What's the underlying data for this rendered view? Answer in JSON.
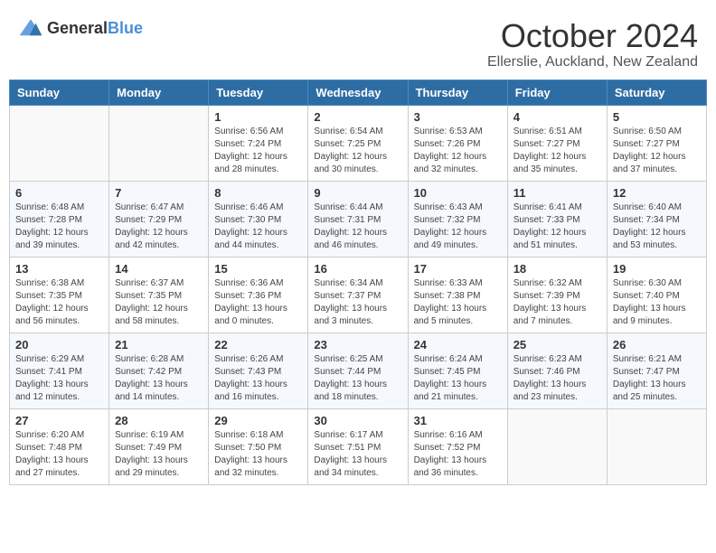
{
  "header": {
    "logo_general": "General",
    "logo_blue": "Blue",
    "month_title": "October 2024",
    "location": "Ellerslie, Auckland, New Zealand"
  },
  "weekdays": [
    "Sunday",
    "Monday",
    "Tuesday",
    "Wednesday",
    "Thursday",
    "Friday",
    "Saturday"
  ],
  "weeks": [
    [
      {
        "day": "",
        "info": ""
      },
      {
        "day": "",
        "info": ""
      },
      {
        "day": "1",
        "info": "Sunrise: 6:56 AM\nSunset: 7:24 PM\nDaylight: 12 hours and 28 minutes."
      },
      {
        "day": "2",
        "info": "Sunrise: 6:54 AM\nSunset: 7:25 PM\nDaylight: 12 hours and 30 minutes."
      },
      {
        "day": "3",
        "info": "Sunrise: 6:53 AM\nSunset: 7:26 PM\nDaylight: 12 hours and 32 minutes."
      },
      {
        "day": "4",
        "info": "Sunrise: 6:51 AM\nSunset: 7:27 PM\nDaylight: 12 hours and 35 minutes."
      },
      {
        "day": "5",
        "info": "Sunrise: 6:50 AM\nSunset: 7:27 PM\nDaylight: 12 hours and 37 minutes."
      }
    ],
    [
      {
        "day": "6",
        "info": "Sunrise: 6:48 AM\nSunset: 7:28 PM\nDaylight: 12 hours and 39 minutes."
      },
      {
        "day": "7",
        "info": "Sunrise: 6:47 AM\nSunset: 7:29 PM\nDaylight: 12 hours and 42 minutes."
      },
      {
        "day": "8",
        "info": "Sunrise: 6:46 AM\nSunset: 7:30 PM\nDaylight: 12 hours and 44 minutes."
      },
      {
        "day": "9",
        "info": "Sunrise: 6:44 AM\nSunset: 7:31 PM\nDaylight: 12 hours and 46 minutes."
      },
      {
        "day": "10",
        "info": "Sunrise: 6:43 AM\nSunset: 7:32 PM\nDaylight: 12 hours and 49 minutes."
      },
      {
        "day": "11",
        "info": "Sunrise: 6:41 AM\nSunset: 7:33 PM\nDaylight: 12 hours and 51 minutes."
      },
      {
        "day": "12",
        "info": "Sunrise: 6:40 AM\nSunset: 7:34 PM\nDaylight: 12 hours and 53 minutes."
      }
    ],
    [
      {
        "day": "13",
        "info": "Sunrise: 6:38 AM\nSunset: 7:35 PM\nDaylight: 12 hours and 56 minutes."
      },
      {
        "day": "14",
        "info": "Sunrise: 6:37 AM\nSunset: 7:35 PM\nDaylight: 12 hours and 58 minutes."
      },
      {
        "day": "15",
        "info": "Sunrise: 6:36 AM\nSunset: 7:36 PM\nDaylight: 13 hours and 0 minutes."
      },
      {
        "day": "16",
        "info": "Sunrise: 6:34 AM\nSunset: 7:37 PM\nDaylight: 13 hours and 3 minutes."
      },
      {
        "day": "17",
        "info": "Sunrise: 6:33 AM\nSunset: 7:38 PM\nDaylight: 13 hours and 5 minutes."
      },
      {
        "day": "18",
        "info": "Sunrise: 6:32 AM\nSunset: 7:39 PM\nDaylight: 13 hours and 7 minutes."
      },
      {
        "day": "19",
        "info": "Sunrise: 6:30 AM\nSunset: 7:40 PM\nDaylight: 13 hours and 9 minutes."
      }
    ],
    [
      {
        "day": "20",
        "info": "Sunrise: 6:29 AM\nSunset: 7:41 PM\nDaylight: 13 hours and 12 minutes."
      },
      {
        "day": "21",
        "info": "Sunrise: 6:28 AM\nSunset: 7:42 PM\nDaylight: 13 hours and 14 minutes."
      },
      {
        "day": "22",
        "info": "Sunrise: 6:26 AM\nSunset: 7:43 PM\nDaylight: 13 hours and 16 minutes."
      },
      {
        "day": "23",
        "info": "Sunrise: 6:25 AM\nSunset: 7:44 PM\nDaylight: 13 hours and 18 minutes."
      },
      {
        "day": "24",
        "info": "Sunrise: 6:24 AM\nSunset: 7:45 PM\nDaylight: 13 hours and 21 minutes."
      },
      {
        "day": "25",
        "info": "Sunrise: 6:23 AM\nSunset: 7:46 PM\nDaylight: 13 hours and 23 minutes."
      },
      {
        "day": "26",
        "info": "Sunrise: 6:21 AM\nSunset: 7:47 PM\nDaylight: 13 hours and 25 minutes."
      }
    ],
    [
      {
        "day": "27",
        "info": "Sunrise: 6:20 AM\nSunset: 7:48 PM\nDaylight: 13 hours and 27 minutes."
      },
      {
        "day": "28",
        "info": "Sunrise: 6:19 AM\nSunset: 7:49 PM\nDaylight: 13 hours and 29 minutes."
      },
      {
        "day": "29",
        "info": "Sunrise: 6:18 AM\nSunset: 7:50 PM\nDaylight: 13 hours and 32 minutes."
      },
      {
        "day": "30",
        "info": "Sunrise: 6:17 AM\nSunset: 7:51 PM\nDaylight: 13 hours and 34 minutes."
      },
      {
        "day": "31",
        "info": "Sunrise: 6:16 AM\nSunset: 7:52 PM\nDaylight: 13 hours and 36 minutes."
      },
      {
        "day": "",
        "info": ""
      },
      {
        "day": "",
        "info": ""
      }
    ]
  ]
}
